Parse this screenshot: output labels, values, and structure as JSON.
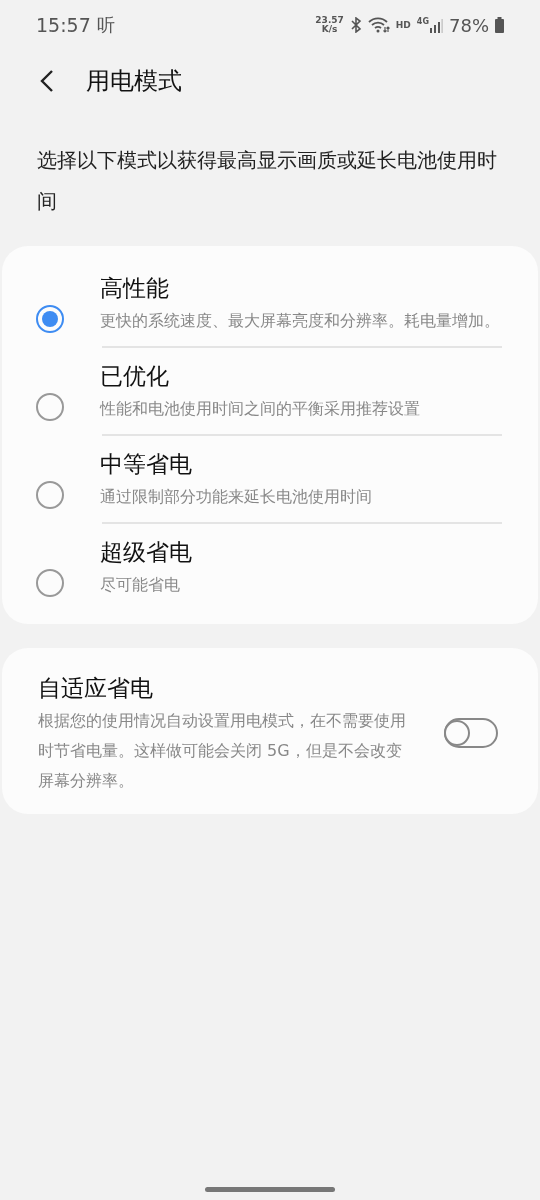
{
  "status_bar": {
    "time": "15:57",
    "notification": "听",
    "net_speed": "23.57",
    "net_unit": "K/s",
    "hd": "HD",
    "network": "4G",
    "battery": "78%"
  },
  "header": {
    "title": "用电模式"
  },
  "description": "选择以下模式以获得最高显示画质或延长电池使用时间",
  "modes": [
    {
      "title": "高性能",
      "subtitle": "更快的系统速度、最大屏幕亮度和分辨率。耗电量增加。",
      "selected": true
    },
    {
      "title": "已优化",
      "subtitle": "性能和电池使用时间之间的平衡采用推荐设置",
      "selected": false
    },
    {
      "title": "中等省电",
      "subtitle": "通过限制部分功能来延长电池使用时间",
      "selected": false
    },
    {
      "title": "超级省电",
      "subtitle": "尽可能省电",
      "selected": false
    }
  ],
  "adaptive": {
    "title": "自适应省电",
    "subtitle": "根据您的使用情况自动设置用电模式，在不需要使用时节省电量。这样做可能会关闭 5G，但是不会改变屏幕分辨率。",
    "on": false
  }
}
